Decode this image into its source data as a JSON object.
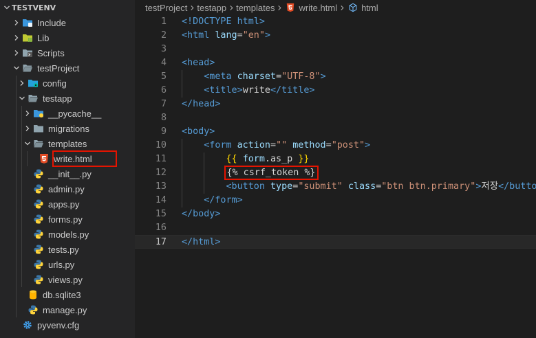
{
  "explorer": {
    "root": "TESTVENV",
    "items": [
      {
        "label": "Include",
        "depth": 0,
        "chevron": "right",
        "icon": "folder-include-icon",
        "color": "#3a96dd"
      },
      {
        "label": "Lib",
        "depth": 0,
        "chevron": "right",
        "icon": "folder-lib-icon",
        "color": "#c0ca33"
      },
      {
        "label": "Scripts",
        "depth": 0,
        "chevron": "right",
        "icon": "folder-scripts-icon",
        "color": "#90a4ae"
      },
      {
        "label": "testProject",
        "depth": 0,
        "chevron": "down",
        "icon": "folder-open-icon",
        "color": "#90a4ae"
      },
      {
        "label": "config",
        "depth": 1,
        "chevron": "right",
        "icon": "folder-config-icon",
        "color": "#26a0da"
      },
      {
        "label": "testapp",
        "depth": 1,
        "chevron": "down",
        "icon": "folder-open-icon",
        "color": "#90a4ae"
      },
      {
        "label": "__pycache__",
        "depth": 2,
        "chevron": "right",
        "icon": "folder-python-icon",
        "color": "#3a96dd"
      },
      {
        "label": "migrations",
        "depth": 2,
        "chevron": "right",
        "icon": "folder-icon",
        "color": "#90a4ae"
      },
      {
        "label": "templates",
        "depth": 2,
        "chevron": "down",
        "icon": "folder-open-icon",
        "color": "#90a4ae"
      },
      {
        "label": "write.html",
        "depth": 3,
        "chevron": "none",
        "icon": "html-file-icon",
        "color": "#e44d26",
        "highlighted": true
      },
      {
        "label": "__init__.py",
        "depth": 2,
        "chevron": "none",
        "icon": "python-file-icon",
        "color": "#3572a5"
      },
      {
        "label": "admin.py",
        "depth": 2,
        "chevron": "none",
        "icon": "python-file-icon",
        "color": "#3572a5"
      },
      {
        "label": "apps.py",
        "depth": 2,
        "chevron": "none",
        "icon": "python-file-icon",
        "color": "#3572a5"
      },
      {
        "label": "forms.py",
        "depth": 2,
        "chevron": "none",
        "icon": "python-file-icon",
        "color": "#3572a5"
      },
      {
        "label": "models.py",
        "depth": 2,
        "chevron": "none",
        "icon": "python-file-icon",
        "color": "#3572a5"
      },
      {
        "label": "tests.py",
        "depth": 2,
        "chevron": "none",
        "icon": "python-file-icon",
        "color": "#3572a5"
      },
      {
        "label": "urls.py",
        "depth": 2,
        "chevron": "none",
        "icon": "python-file-icon",
        "color": "#3572a5"
      },
      {
        "label": "views.py",
        "depth": 2,
        "chevron": "none",
        "icon": "python-file-icon",
        "color": "#3572a5"
      },
      {
        "label": "db.sqlite3",
        "depth": 1,
        "chevron": "none",
        "icon": "database-file-icon",
        "color": "#3a96dd"
      },
      {
        "label": "manage.py",
        "depth": 1,
        "chevron": "none",
        "icon": "python-file-icon",
        "color": "#3572a5"
      },
      {
        "label": "pyvenv.cfg",
        "depth": 0,
        "chevron": "none",
        "icon": "gear-file-icon",
        "color": "#42a5f5"
      }
    ]
  },
  "breadcrumb": [
    {
      "label": "testProject",
      "icon": null
    },
    {
      "label": "testapp",
      "icon": null
    },
    {
      "label": "templates",
      "icon": null
    },
    {
      "label": "write.html",
      "icon": "html-file-icon"
    },
    {
      "label": "html",
      "icon": "element-cube-icon"
    }
  ],
  "editor": {
    "current_line": 17,
    "lines": [
      {
        "n": "1",
        "tokens": [
          [
            "t-tag",
            "<!DOCTYPE html>"
          ]
        ]
      },
      {
        "n": "2",
        "tokens": [
          [
            "t-tag",
            "<html"
          ],
          [
            "t-plain",
            " "
          ],
          [
            "t-attr",
            "lang"
          ],
          [
            "t-plain",
            "="
          ],
          [
            "t-str",
            "\"en\""
          ],
          [
            "t-tag",
            ">"
          ]
        ]
      },
      {
        "n": "3",
        "tokens": []
      },
      {
        "n": "4",
        "tokens": [
          [
            "t-tag",
            "<head>"
          ]
        ]
      },
      {
        "n": "5",
        "tokens": [
          [
            "t-plain",
            "    "
          ],
          [
            "t-tag",
            "<meta"
          ],
          [
            "t-plain",
            " "
          ],
          [
            "t-attr",
            "charset"
          ],
          [
            "t-plain",
            "="
          ],
          [
            "t-str",
            "\"UTF-8\""
          ],
          [
            "t-tag",
            ">"
          ]
        ]
      },
      {
        "n": "6",
        "tokens": [
          [
            "t-plain",
            "    "
          ],
          [
            "t-tag",
            "<title>"
          ],
          [
            "t-text",
            "write"
          ],
          [
            "t-tag",
            "</title>"
          ]
        ]
      },
      {
        "n": "7",
        "tokens": [
          [
            "t-tag",
            "</head>"
          ]
        ]
      },
      {
        "n": "8",
        "tokens": []
      },
      {
        "n": "9",
        "tokens": [
          [
            "t-tag",
            "<body>"
          ]
        ]
      },
      {
        "n": "10",
        "tokens": [
          [
            "t-plain",
            "    "
          ],
          [
            "t-tag",
            "<form"
          ],
          [
            "t-plain",
            " "
          ],
          [
            "t-attr",
            "action"
          ],
          [
            "t-plain",
            "="
          ],
          [
            "t-str",
            "\"\""
          ],
          [
            "t-plain",
            " "
          ],
          [
            "t-attr",
            "method"
          ],
          [
            "t-plain",
            "="
          ],
          [
            "t-str",
            "\"post\""
          ],
          [
            "t-tag",
            ">"
          ]
        ]
      },
      {
        "n": "11",
        "tokens": [
          [
            "t-plain",
            "        "
          ],
          [
            "t-brace",
            "{{"
          ],
          [
            "t-plain",
            " "
          ],
          [
            "t-var",
            "form"
          ],
          [
            "t-plain",
            ".as_p "
          ],
          [
            "t-brace",
            "}}"
          ]
        ]
      },
      {
        "n": "12",
        "tokens": [
          [
            "t-plain",
            "        "
          ],
          [
            "t-tpl",
            "{% csrf_token %}"
          ]
        ],
        "boxed": true
      },
      {
        "n": "13",
        "tokens": [
          [
            "t-plain",
            "        "
          ],
          [
            "t-tag",
            "<button"
          ],
          [
            "t-plain",
            " "
          ],
          [
            "t-attr",
            "type"
          ],
          [
            "t-plain",
            "="
          ],
          [
            "t-str",
            "\"submit\""
          ],
          [
            "t-plain",
            " "
          ],
          [
            "t-attr",
            "class"
          ],
          [
            "t-plain",
            "="
          ],
          [
            "t-str",
            "\"btn btn.primary\""
          ],
          [
            "t-tag",
            ">"
          ],
          [
            "t-text",
            "저장"
          ],
          [
            "t-tag",
            "</button>"
          ]
        ]
      },
      {
        "n": "14",
        "tokens": [
          [
            "t-plain",
            "    "
          ],
          [
            "t-tag",
            "</form>"
          ]
        ]
      },
      {
        "n": "15",
        "tokens": [
          [
            "t-tag",
            "</body>"
          ]
        ]
      },
      {
        "n": "16",
        "tokens": []
      },
      {
        "n": "17",
        "tokens": [
          [
            "t-tag",
            "</html>"
          ]
        ]
      }
    ]
  }
}
